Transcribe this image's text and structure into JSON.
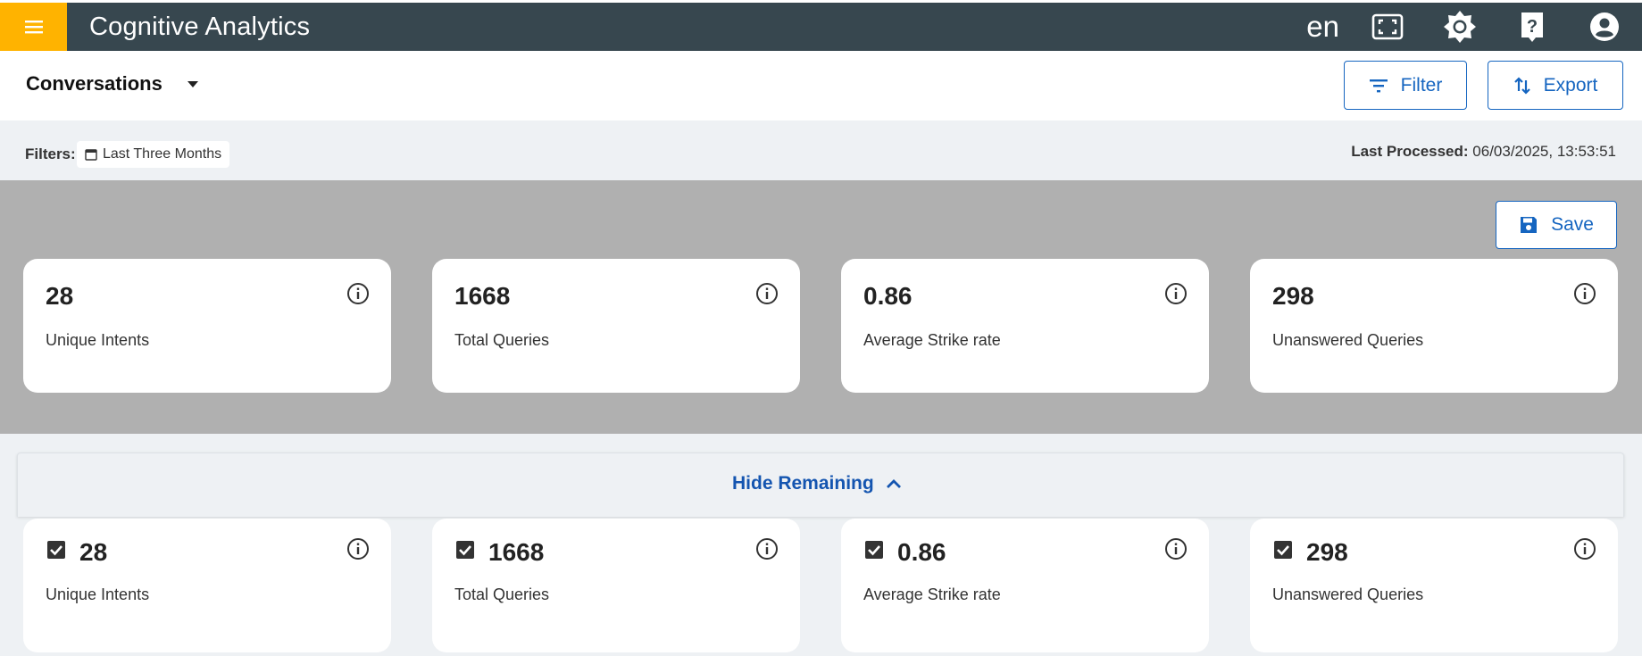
{
  "app": {
    "title": "Cognitive Analytics",
    "language": "en"
  },
  "colors": {
    "appbar": "#37474f",
    "menu_accent": "#ffb300",
    "primary": "#1565c0",
    "link": "#1455b0"
  },
  "appbar_icons": [
    "fullscreen-icon",
    "brightness-icon",
    "help-icon",
    "account-icon"
  ],
  "subheader": {
    "section": "Conversations",
    "filter_label": "Filter",
    "export_label": "Export"
  },
  "filters": {
    "label": "Filters:",
    "chip": "Last Three Months",
    "last_processed_label": "Last Processed:",
    "last_processed_value": "06/03/2025, 13:53:51"
  },
  "save_label": "Save",
  "summary_cards": [
    {
      "value": "28",
      "label": "Unique Intents"
    },
    {
      "value": "1668",
      "label": "Total Queries"
    },
    {
      "value": "0.86",
      "label": "Average Strike rate"
    },
    {
      "value": "298",
      "label": "Unanswered Queries"
    }
  ],
  "toggle_label": "Hide Remaining",
  "selectable_cards": [
    {
      "value": "28",
      "label": "Unique Intents",
      "checked": true
    },
    {
      "value": "1668",
      "label": "Total Queries",
      "checked": true
    },
    {
      "value": "0.86",
      "label": "Average Strike rate",
      "checked": true
    },
    {
      "value": "298",
      "label": "Unanswered Queries",
      "checked": true
    }
  ]
}
